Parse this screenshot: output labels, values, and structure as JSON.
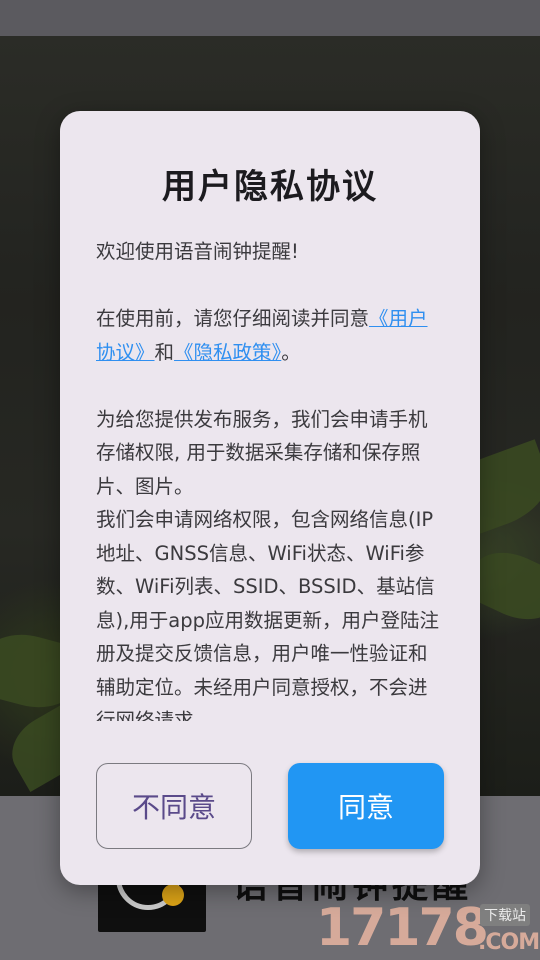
{
  "background": {
    "app_name": "语音闹钟提醒",
    "watermark_text": "17178",
    "watermark_tag": "下载站",
    "watermark_domain": ".COM"
  },
  "dialog": {
    "title": "用户隐私协议",
    "welcome": "欢迎使用语音闹钟提醒!",
    "consent_prefix": "在使用前，请您仔细阅读并同意",
    "user_agreement_link": "《用户协议》",
    "consent_and": "和",
    "privacy_policy_link": "《隐私政策》",
    "consent_suffix": "。",
    "storage_permission": "为给您提供发布服务，我们会申请手机存储权限, 用于数据采集存储和保存照片、图片。",
    "network_permission": "我们会申请网络权限，包含网络信息(IP地址、GNSS信息、WiFi状态、WiFi参数、WiFi列表、SSID、BSSID、基站信息),用于app应用数据更新，用户登陆注册及提交反馈信息，用户唯一性验证和辅助定位。未经用户同意授权，不会进行网络请求",
    "disagree_label": "不同意",
    "agree_label": "同意"
  },
  "colors": {
    "agree_button": "#2196f3",
    "link": "#2f8ff0",
    "dialog_bg": "#ece6ee"
  }
}
